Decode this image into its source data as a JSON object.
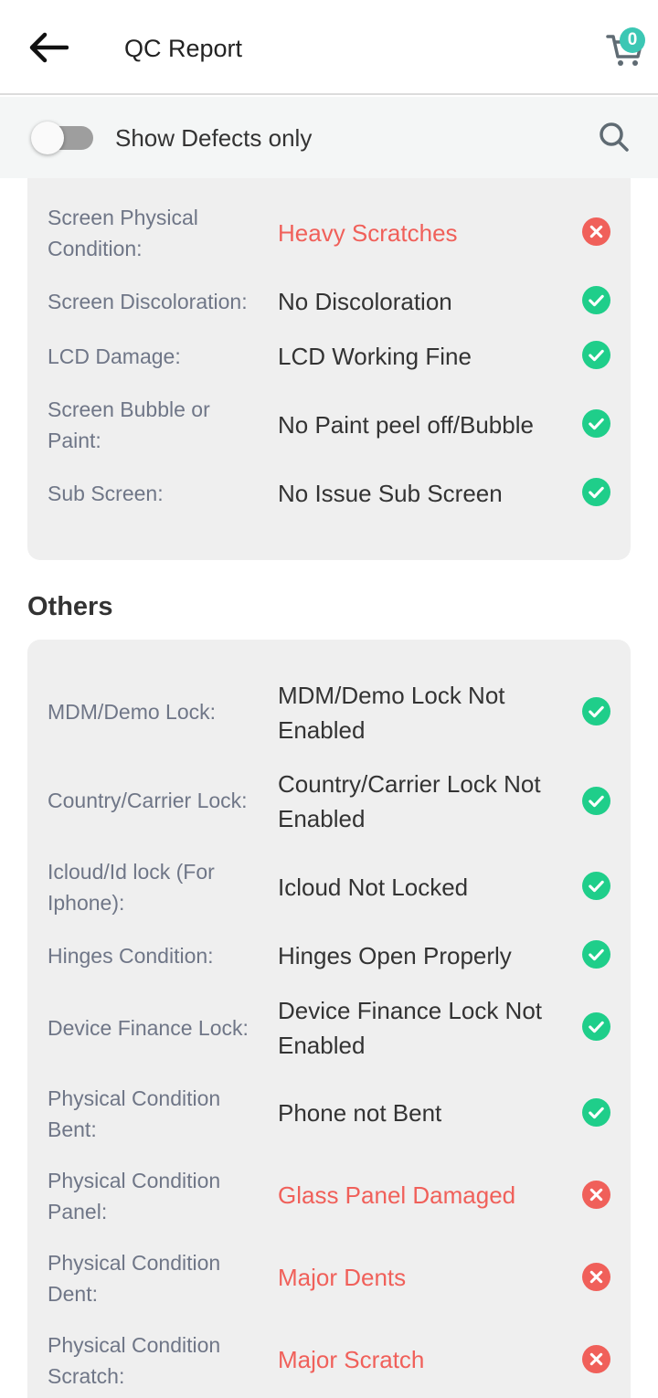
{
  "header": {
    "title": "QC Report",
    "cart_count": "0"
  },
  "filter": {
    "show_defects_label": "Show Defects only",
    "show_defects_on": false
  },
  "colors": {
    "pass": "#1fce8a",
    "fail": "#f0605a",
    "accent": "#3cc7b4"
  },
  "screen_section": {
    "rows": [
      {
        "label": "Screen Physical Condition:",
        "value": "Heavy Scratches",
        "status": "fail"
      },
      {
        "label": "Screen Discoloration:",
        "value": "No Discoloration",
        "status": "pass"
      },
      {
        "label": "LCD Damage:",
        "value": "LCD Working Fine",
        "status": "pass"
      },
      {
        "label": "Screen Bubble or Paint:",
        "value": "No Paint peel off/Bubble",
        "status": "pass"
      },
      {
        "label": "Sub Screen:",
        "value": "No Issue Sub Screen",
        "status": "pass"
      }
    ]
  },
  "others_section": {
    "title": "Others",
    "rows": [
      {
        "label": "MDM/Demo Lock:",
        "value": "MDM/Demo Lock Not Enabled",
        "status": "pass"
      },
      {
        "label": "Country/Carrier Lock:",
        "value": "Country/Carrier Lock Not Enabled",
        "status": "pass"
      },
      {
        "label": "Icloud/Id lock (For Iphone):",
        "value": "Icloud Not Locked",
        "status": "pass"
      },
      {
        "label": "Hinges Condition:",
        "value": "Hinges Open Properly",
        "status": "pass"
      },
      {
        "label": "Device Finance Lock:",
        "value": "Device Finance Lock Not Enabled",
        "status": "pass"
      },
      {
        "label": "Physical Condition Bent:",
        "value": "Phone not Bent",
        "status": "pass"
      },
      {
        "label": "Physical Condition Panel:",
        "value": "Glass Panel Damaged",
        "status": "fail"
      },
      {
        "label": "Physical Condition Dent:",
        "value": "Major Dents",
        "status": "fail"
      },
      {
        "label": "Physical Condition Scratch:",
        "value": "Major Scratch",
        "status": "fail"
      }
    ]
  }
}
